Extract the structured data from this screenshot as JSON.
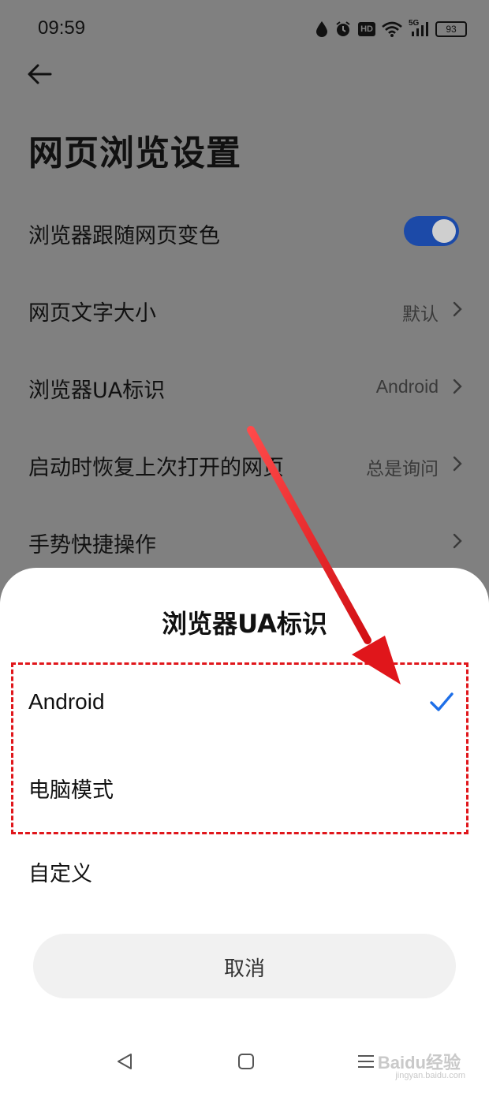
{
  "status_bar": {
    "time": "09:59",
    "battery": "93",
    "network": "5G",
    "hd_badge": "HD",
    "icons": [
      "water-drop-icon",
      "alarm-icon",
      "hd-icon",
      "wifi-icon",
      "signal-icon",
      "battery-icon"
    ]
  },
  "header": {
    "back_icon": "arrow-left-icon",
    "title": "网页浏览设置"
  },
  "settings": {
    "items": [
      {
        "label": "浏览器跟随网页变色",
        "control": "toggle",
        "on": true
      },
      {
        "label": "网页文字大小",
        "value": "默认"
      },
      {
        "label": "浏览器UA标识",
        "value": "Android"
      },
      {
        "label": "启动时恢复上次打开的网页",
        "value": "总是询问"
      },
      {
        "label": "手势快捷操作",
        "value": ""
      }
    ]
  },
  "dialog": {
    "title": "浏览器UA标识",
    "options": [
      {
        "label": "Android",
        "selected": true
      },
      {
        "label": "电脑模式",
        "selected": false
      },
      {
        "label": "自定义",
        "selected": false
      }
    ],
    "cancel_label": "取消"
  },
  "nav_bar": {
    "icons": [
      "nav-back-icon",
      "nav-home-icon",
      "nav-menu-icon"
    ]
  },
  "watermark": {
    "text": "Baidu经验",
    "url": "jingyan.baidu.com"
  },
  "colors": {
    "accent": "#1e6fe8",
    "annotation": "#e0161b",
    "dim_overlay": "#808080"
  }
}
